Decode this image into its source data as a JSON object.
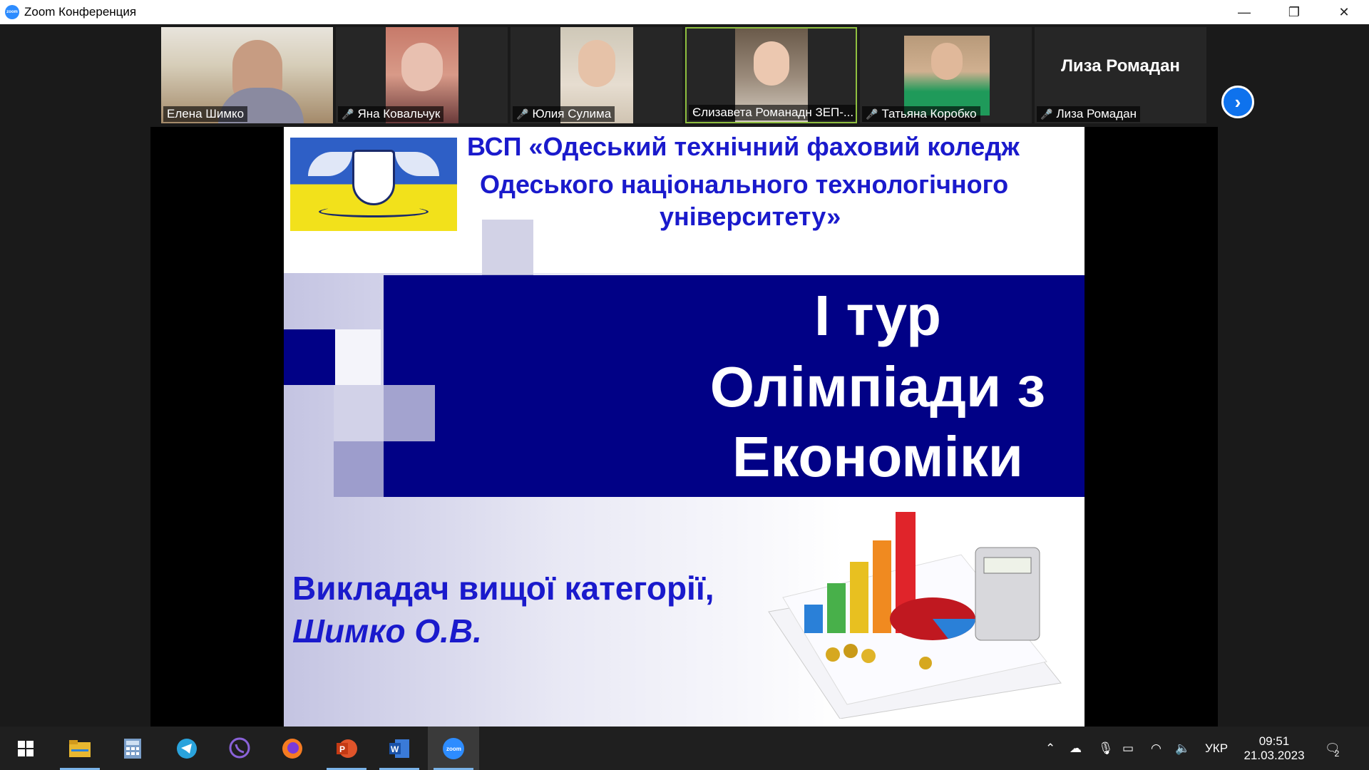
{
  "window": {
    "app_icon_text": "zoom",
    "title": "Zoom Конференция",
    "minimize": "—",
    "restore": "❐",
    "close": "✕"
  },
  "participants": [
    {
      "name": "Елена Шимко",
      "muted": false,
      "active": false
    },
    {
      "name": "Яна Ковальчук",
      "muted": true,
      "active": false
    },
    {
      "name": "Юлия Сулима",
      "muted": true,
      "active": false
    },
    {
      "name": "Єлизавета Романадн ЗЕП-...",
      "muted": false,
      "active": true
    },
    {
      "name": "Татьяна Коробко",
      "muted": true,
      "active": false
    },
    {
      "name": "Лиза Ромадан",
      "muted": true,
      "active": false,
      "big_name": "Лиза Ромадан"
    }
  ],
  "next_page_icon": "chevron-right-icon",
  "slide": {
    "institution_line1": "ВСП «Одеський технічний фаховий коледж",
    "institution_line2": "Одеського національного технологічного",
    "institution_line3": "університету»",
    "title_line1": "І тур",
    "title_line2": "Олімпіади з",
    "title_line3": "Економіки",
    "teacher_line1": "Викладач вищої категорії,",
    "teacher_line2": "Шимко О.В."
  },
  "taskbar": {
    "apps": [
      "windows-start-icon",
      "file-explorer-icon",
      "calculator-icon",
      "telegram-icon",
      "viber-icon",
      "firefox-icon",
      "powerpoint-icon",
      "word-icon",
      "zoom-icon"
    ],
    "tray": {
      "language": "УКР",
      "time": "09:51",
      "date": "21.03.2023",
      "notifications": "2"
    }
  },
  "colors": {
    "accent_blue": "#010186",
    "text_blue": "#1a1acc",
    "zoom_blue": "#0e72ed",
    "active_border": "#8fbf3f"
  }
}
